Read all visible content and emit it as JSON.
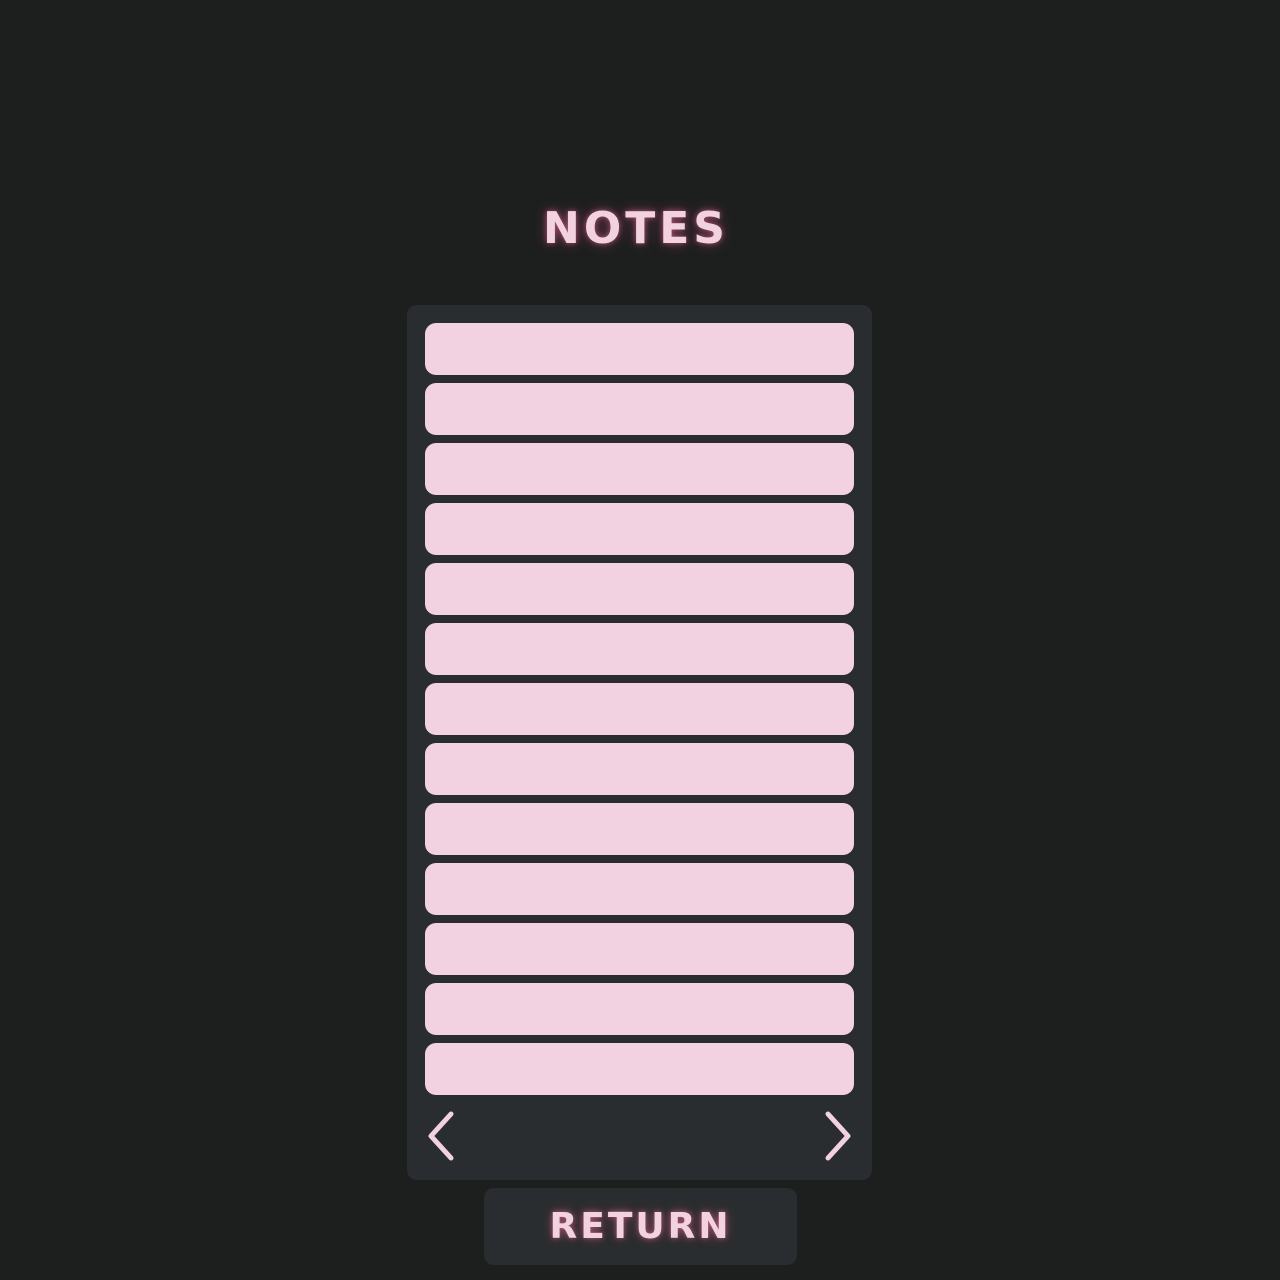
{
  "title": "NOTES",
  "notes_list": {
    "slot_count": 13
  },
  "pager": {
    "prev_icon": "chevron-left-icon",
    "next_icon": "chevron-right-icon"
  },
  "return_button": {
    "label": "RETURN"
  },
  "colors": {
    "background": "#1d1f1f",
    "panel": "#2a2d2f",
    "accent_pink": "#f2d2e0",
    "glow": "#ff78aa"
  }
}
